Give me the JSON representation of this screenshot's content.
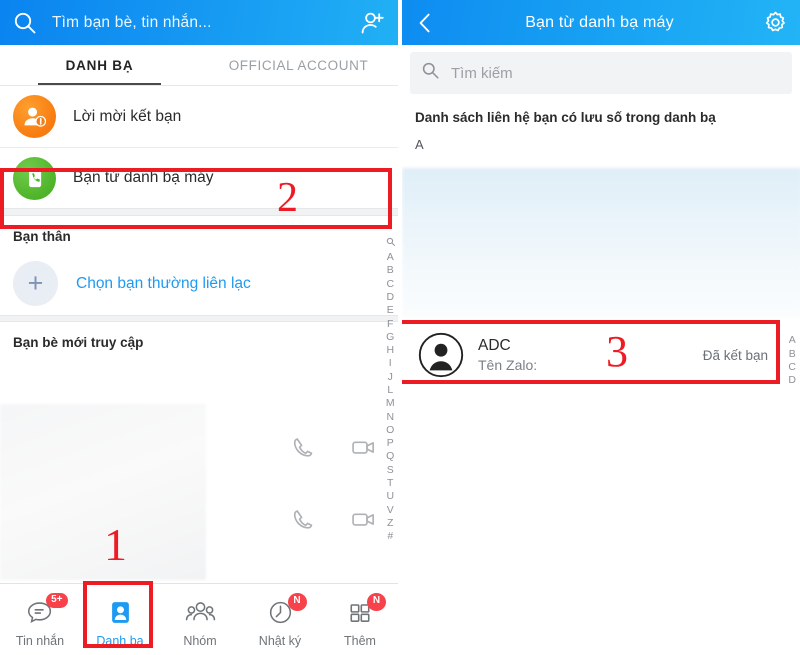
{
  "left": {
    "header": {
      "search_placeholder": "Tìm bạn bè, tin nhắn...",
      "search_icon": "search-icon",
      "add_friend_icon": "add-friend-icon"
    },
    "tabs": [
      {
        "label": "DANH BẠ",
        "active": true
      },
      {
        "label": "OFFICIAL ACCOUNT",
        "active": false
      }
    ],
    "rows": [
      {
        "label": "Lời mời kết bạn",
        "icon": "friend-request-icon"
      },
      {
        "label": "Bạn từ danh bạ máy",
        "icon": "phonebook-contact-icon"
      }
    ],
    "close_friends": {
      "title": "Bạn thân",
      "pick_label": "Chọn bạn thường liên lạc",
      "plus_icon": "plus-icon"
    },
    "recent": {
      "title": "Bạn bè mới truy cập",
      "call_icon": "phone-call-icon",
      "video_icon": "video-call-icon"
    },
    "alpha_index": [
      "Q",
      "A",
      "B",
      "C",
      "D",
      "E",
      "F",
      "G",
      "H",
      "I",
      "J",
      "L",
      "M",
      "N",
      "O",
      "P",
      "Q",
      "S",
      "T",
      "U",
      "V",
      "Z",
      "#"
    ],
    "bottom_nav": [
      {
        "label": "Tin nhắn",
        "icon": "message-icon",
        "badge": "5+",
        "active": false
      },
      {
        "label": "Danh bạ",
        "icon": "contacts-icon",
        "badge": "",
        "active": true
      },
      {
        "label": "Nhóm",
        "icon": "group-icon",
        "badge": "",
        "active": false
      },
      {
        "label": "Nhật ký",
        "icon": "diary-clock-icon",
        "badge": "N",
        "active": false
      },
      {
        "label": "Thêm",
        "icon": "more-grid-icon",
        "badge": "N",
        "active": false
      }
    ]
  },
  "right": {
    "header": {
      "title": "Bạn từ danh bạ máy",
      "back_icon": "back-chevron-icon",
      "settings_icon": "gear-icon"
    },
    "search": {
      "placeholder": "Tìm kiếm",
      "icon": "search-icon"
    },
    "note": "Danh sách liên hệ bạn có lưu số trong danh bạ",
    "letter_header": "A",
    "contact": {
      "avatar_icon": "person-avatar-icon",
      "name": "ADC",
      "subtitle": "Tên Zalo:",
      "status": "Đã kết bạn"
    },
    "alpha_index": [
      "A",
      "B",
      "C",
      "D"
    ]
  },
  "annotations": [
    {
      "number": "1"
    },
    {
      "number": "2"
    },
    {
      "number": "3"
    }
  ],
  "colors": {
    "accent_blue": "#1e9bf0",
    "header_blue": "#0a84f0",
    "annotation_red": "#ed1c24",
    "badge_red": "#f8424b",
    "orange": "#f77b10",
    "green": "#4cb226"
  }
}
